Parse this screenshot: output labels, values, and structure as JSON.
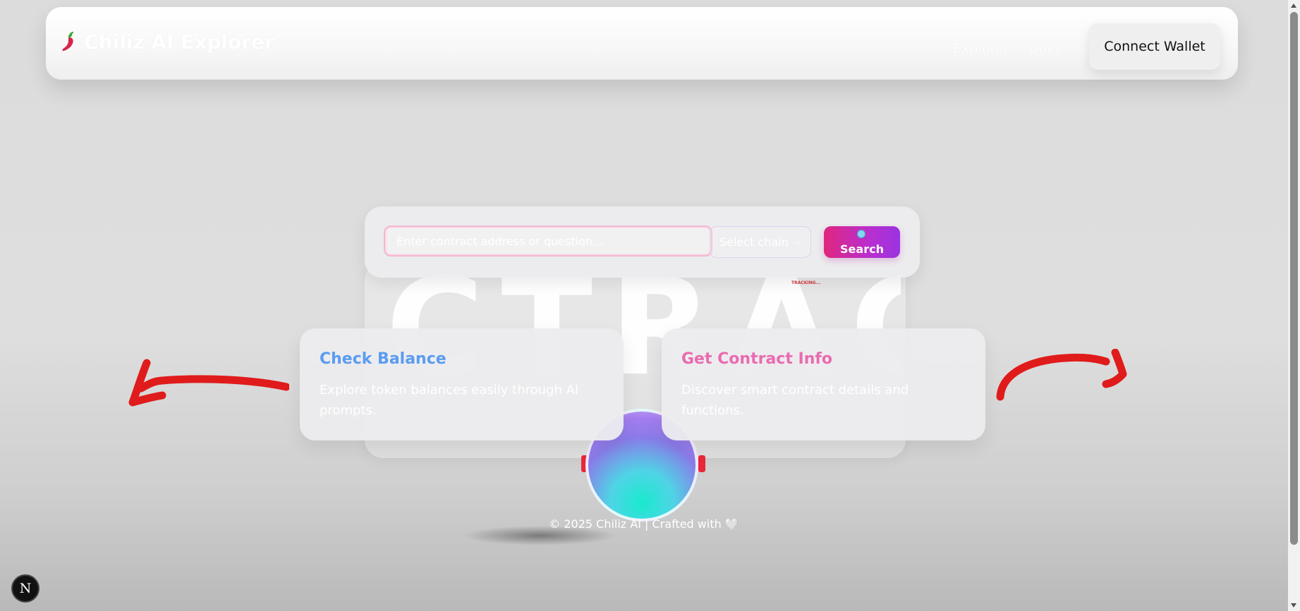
{
  "header": {
    "brand_title": "Chiliz AI Explorer",
    "brand_icon": "chili-pepper-icon",
    "nav_links": [
      {
        "label": "Explorer"
      },
      {
        "label": "Docs"
      }
    ],
    "connect_label": "Connect Wallet"
  },
  "search": {
    "placeholder": "Enter contract address or question...",
    "chain_label": "Select chain",
    "button_label": "Search"
  },
  "hero": {
    "big_text": "CTRACE",
    "tiny_tag": "TRACKING..."
  },
  "cards": [
    {
      "title": "Check Balance",
      "description": "Explore token balances easily through AI prompts."
    },
    {
      "title": "Get Contract Info",
      "description": "Discover smart contract details and functions."
    }
  ],
  "footer": {
    "text": "© 2025 Chiliz AI | Crafted with 🤍"
  },
  "devtools": {
    "badge_label": "N"
  },
  "colors": {
    "accent_pink": "#e0267f",
    "accent_purple": "#9a33e0",
    "card_title_blue": "#5b9cf0",
    "card_title_pink": "#ea6bb0",
    "arrow_red": "#e01b1b"
  }
}
